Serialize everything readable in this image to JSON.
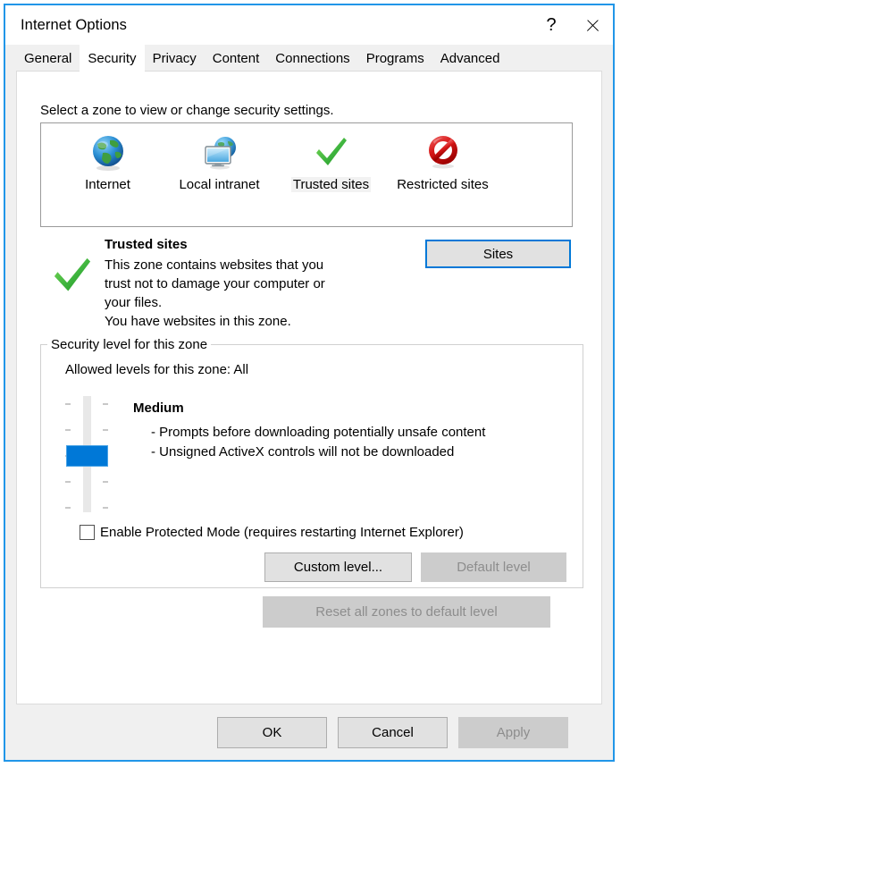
{
  "window": {
    "title": "Internet Options",
    "help_icon": "question-mark-icon",
    "close_icon": "close-icon",
    "border_color": "#2196e8"
  },
  "tabs": [
    {
      "label": "General",
      "active": false
    },
    {
      "label": "Security",
      "active": true
    },
    {
      "label": "Privacy",
      "active": false
    },
    {
      "label": "Content",
      "active": false
    },
    {
      "label": "Connections",
      "active": false
    },
    {
      "label": "Programs",
      "active": false
    },
    {
      "label": "Advanced",
      "active": false
    }
  ],
  "security": {
    "intro": "Select a zone to view or change security settings.",
    "zones": [
      {
        "label": "Internet",
        "icon": "globe-icon",
        "selected": false
      },
      {
        "label": "Local intranet",
        "icon": "monitor-globe-icon",
        "selected": false
      },
      {
        "label": "Trusted sites",
        "icon": "green-check-icon",
        "selected": true
      },
      {
        "label": "Restricted sites",
        "icon": "red-prohibition-icon",
        "selected": false
      }
    ],
    "selected_zone": {
      "icon": "green-check-icon",
      "title": "Trusted sites",
      "description_lines": [
        "This zone contains websites that you",
        "trust not to damage your computer or",
        "your files.",
        "You have websites in this zone."
      ]
    },
    "sites_button": {
      "label": "Sites",
      "focused": true,
      "disabled": false
    },
    "level_group": {
      "legend": "Security level for this zone",
      "allowed_levels": "Allowed levels for this zone: All",
      "slider": {
        "tick_count": 5,
        "position_index": 2,
        "thumb_color": "#0078d7",
        "track_color": "#e8e8e8"
      },
      "level_name": "Medium",
      "level_bullets": [
        "- Prompts before downloading potentially unsafe content",
        "- Unsigned ActiveX controls will not be downloaded"
      ],
      "protected_mode": {
        "label": "Enable Protected Mode (requires restarting Internet Explorer)",
        "checked": false
      },
      "custom_level_button": {
        "label": "Custom level...",
        "disabled": false
      },
      "default_level_button": {
        "label": "Default level",
        "disabled": true
      }
    },
    "reset_button": {
      "label": "Reset all zones to default level",
      "disabled": true
    }
  },
  "footer": {
    "ok": {
      "label": "OK",
      "disabled": false
    },
    "cancel": {
      "label": "Cancel",
      "disabled": false
    },
    "apply": {
      "label": "Apply",
      "disabled": true
    }
  }
}
